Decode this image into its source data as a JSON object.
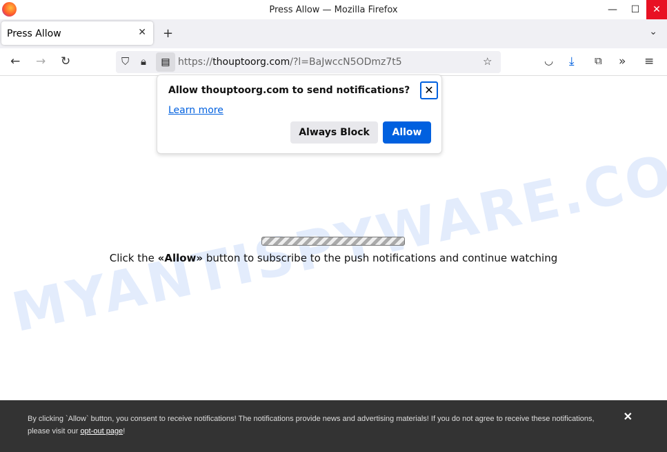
{
  "window": {
    "title": "Press Allow — Mozilla Firefox"
  },
  "tab": {
    "label": "Press Allow"
  },
  "url": {
    "prefix": "https://",
    "domain": "thouptoorg.com",
    "path": "/?l=BaJwccN5ODmz7t5"
  },
  "popup": {
    "title": "Allow thouptoorg.com to send notifications?",
    "learn_more": "Learn more",
    "block_label": "Always Block",
    "allow_label": "Allow"
  },
  "page": {
    "message_pre": "Click the ",
    "message_bold": "«Allow»",
    "message_post": " button to subscribe to the push notifications and continue watching",
    "progress_state": "indeterminate"
  },
  "watermark": "MYANTISPYWARE.COM",
  "footer": {
    "text": "By clicking `Allow` button, you consent to receive notifications! The notifications provide news and advertising materials! If you do not agree to receive these notifications, please visit our ",
    "link": "opt-out page",
    "end": "!"
  },
  "colors": {
    "accent": "#0060df",
    "close_red": "#e81123",
    "footer_bg": "#333333"
  }
}
